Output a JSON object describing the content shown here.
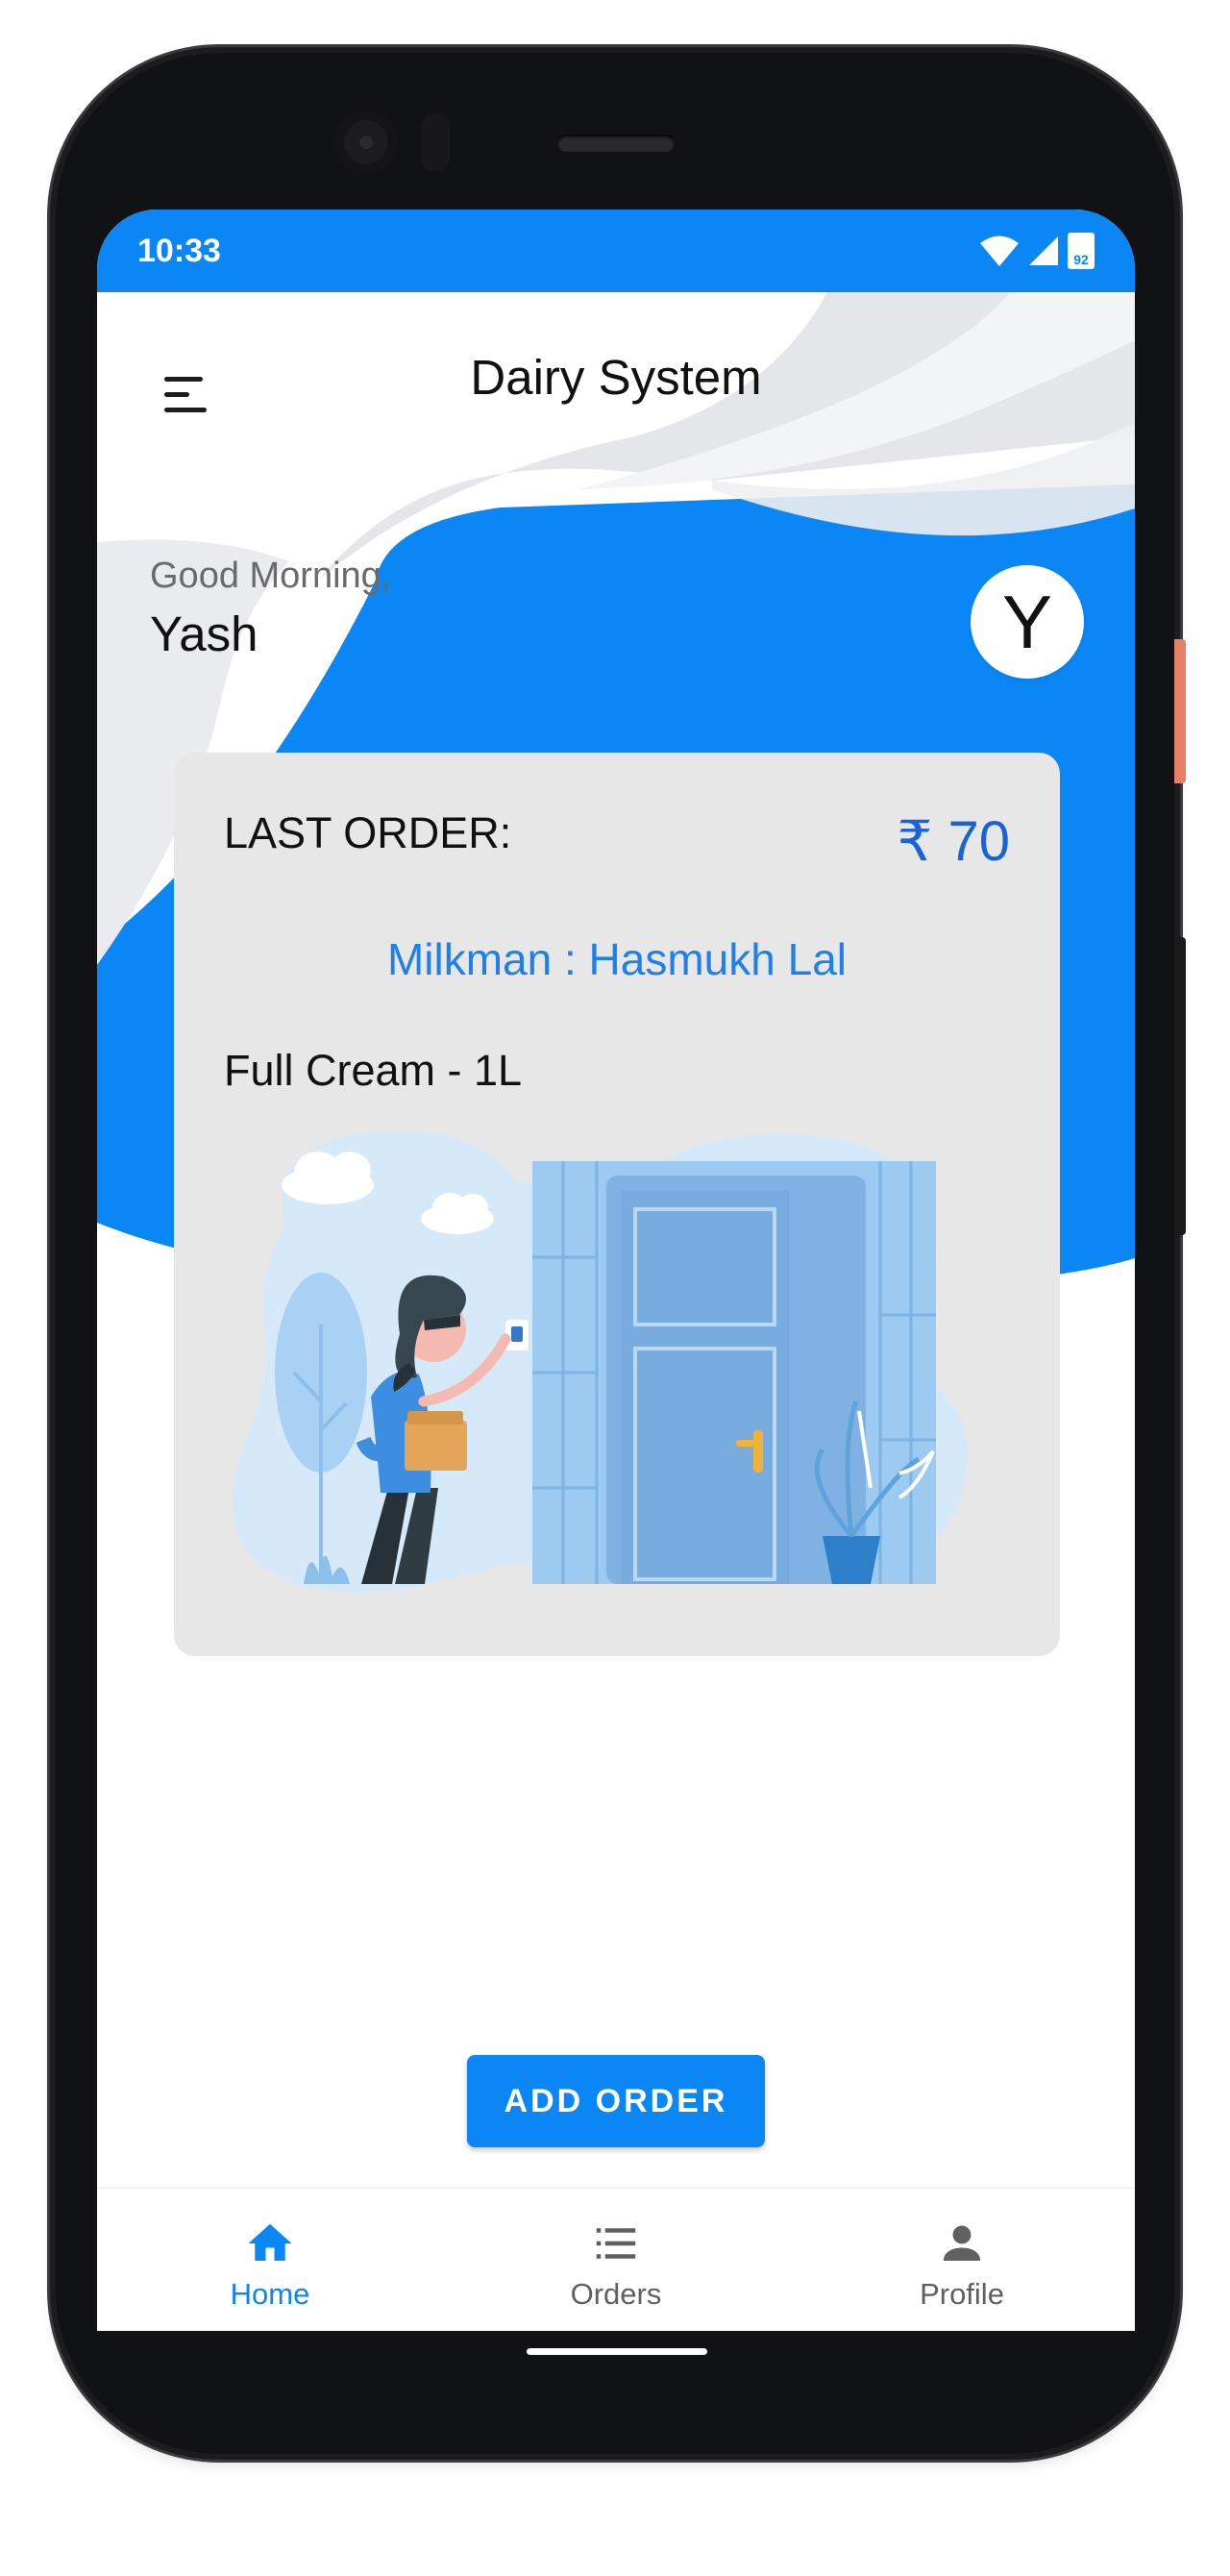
{
  "status_bar": {
    "time": "10:33",
    "battery": "92"
  },
  "header": {
    "title": "Dairy System"
  },
  "greeting": {
    "salutation": "Good Morning,",
    "name": "Yash",
    "avatar_initial": "Y"
  },
  "last_order": {
    "label": "LAST ORDER:",
    "price": "₹ 70",
    "milkman": "Milkman : Hasmukh Lal",
    "item": "Full Cream - 1L"
  },
  "actions": {
    "add_order": "ADD ORDER"
  },
  "bottom_nav": {
    "items": [
      {
        "label": "Home",
        "icon": "home-icon",
        "active": true
      },
      {
        "label": "Orders",
        "icon": "list-icon",
        "active": false
      },
      {
        "label": "Profile",
        "icon": "person-icon",
        "active": false
      }
    ]
  },
  "colors": {
    "primary": "#0b87f5",
    "price": "#1a63d6",
    "milkman": "#1f80e8",
    "card": "#e7e7e7",
    "inactive": "#606060"
  }
}
